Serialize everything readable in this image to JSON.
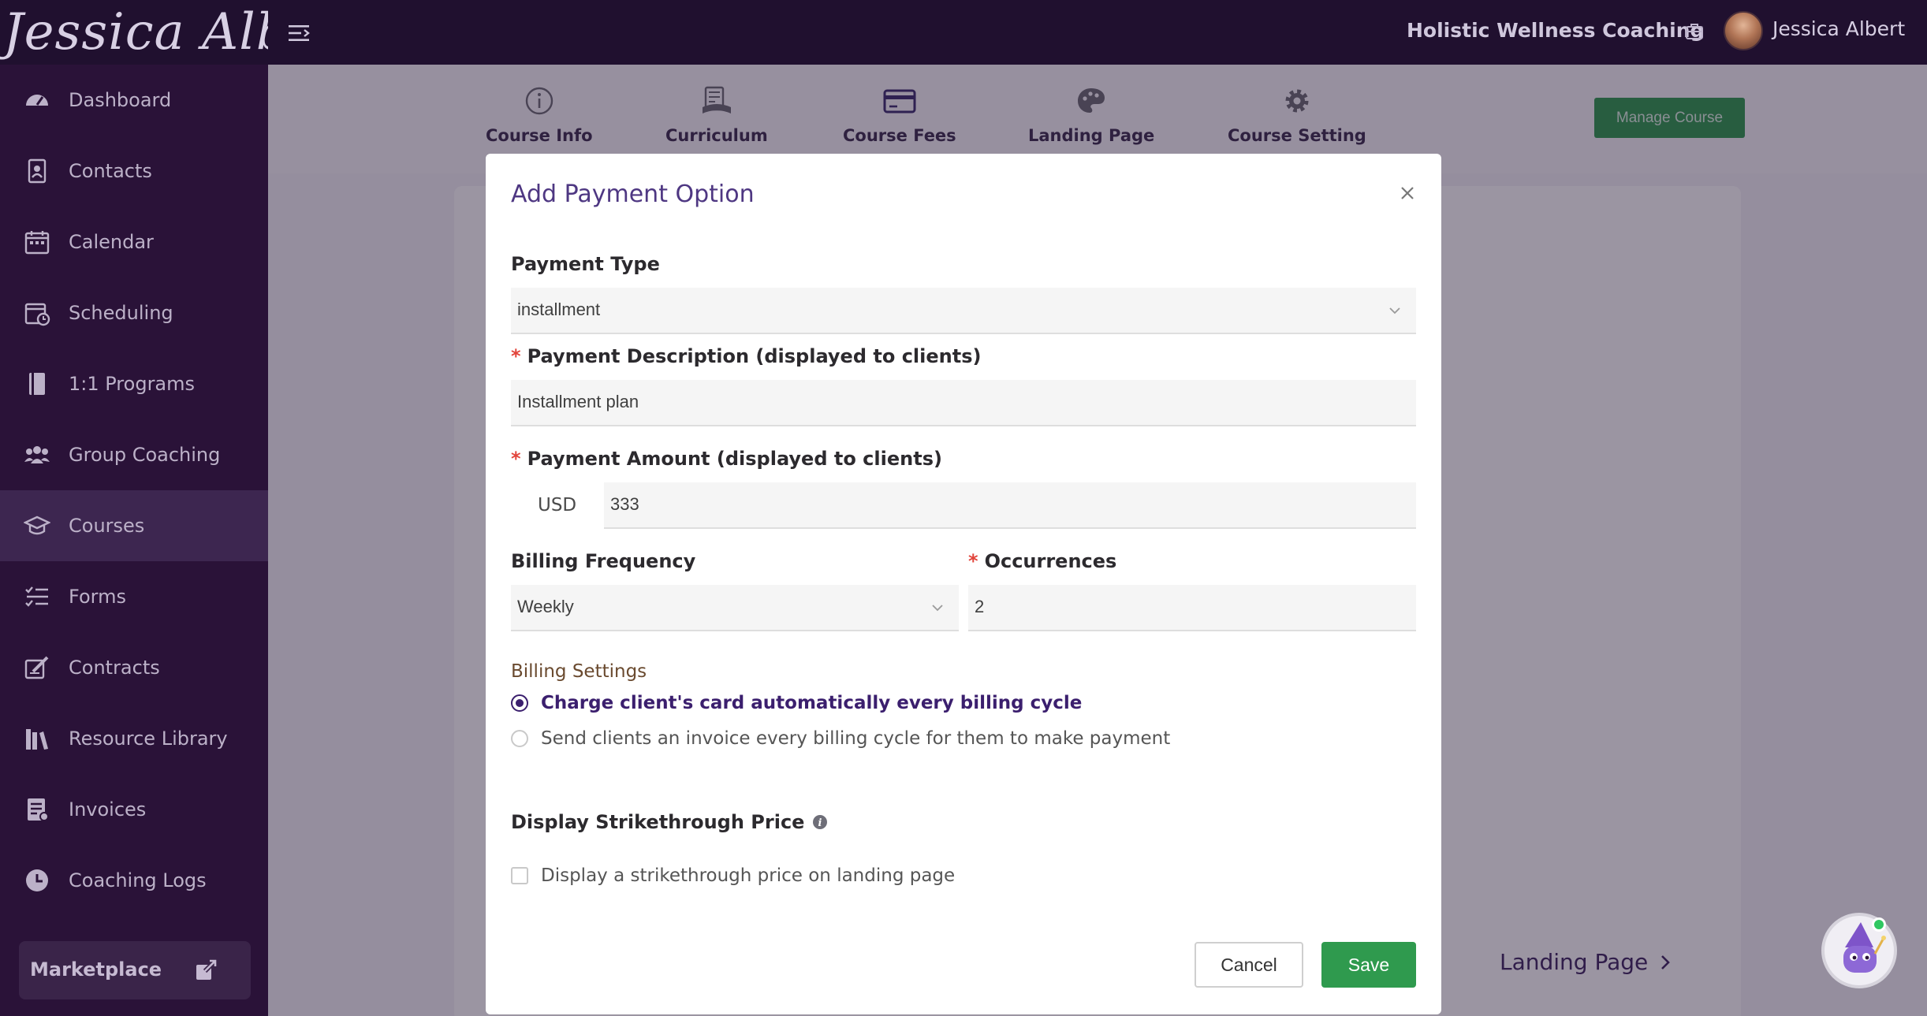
{
  "header": {
    "logo_text": "Jessica Albert",
    "org_name": "Holistic Wellness Coaching",
    "user_name": "Jessica Albert"
  },
  "sidebar": {
    "items": [
      {
        "label": "Dashboard",
        "icon": "dashboard-icon"
      },
      {
        "label": "Contacts",
        "icon": "contacts-icon"
      },
      {
        "label": "Calendar",
        "icon": "calendar-icon"
      },
      {
        "label": "Scheduling",
        "icon": "scheduling-icon"
      },
      {
        "label": "1:1 Programs",
        "icon": "programs-icon"
      },
      {
        "label": "Group Coaching",
        "icon": "group-icon"
      },
      {
        "label": "Courses",
        "icon": "courses-icon",
        "active": true
      },
      {
        "label": "Forms",
        "icon": "forms-icon"
      },
      {
        "label": "Contracts",
        "icon": "contracts-icon"
      },
      {
        "label": "Resource Library",
        "icon": "library-icon"
      },
      {
        "label": "Invoices",
        "icon": "invoices-icon"
      },
      {
        "label": "Coaching Logs",
        "icon": "clock-icon"
      }
    ],
    "marketplace_label": "Marketplace"
  },
  "course_tabs": [
    {
      "label": "Course Info",
      "icon": "info-icon"
    },
    {
      "label": "Curriculum",
      "icon": "curriculum-icon"
    },
    {
      "label": "Course Fees",
      "icon": "credit-card-icon",
      "active": true
    },
    {
      "label": "Landing Page",
      "icon": "palette-icon"
    },
    {
      "label": "Course Setting",
      "icon": "gear-icon"
    }
  ],
  "manage_course_label": "Manage Course",
  "landing_page_link": "Landing Page",
  "modal": {
    "title": "Add Payment Option",
    "payment_type_label": "Payment Type",
    "payment_type_value": "installment",
    "description_label": "Payment Description (displayed to clients)",
    "description_value": "Installment plan",
    "amount_label": "Payment Amount (displayed to clients)",
    "currency": "USD",
    "amount_value": "333",
    "billing_frequency_label": "Billing Frequency",
    "billing_frequency_value": "Weekly",
    "occurrences_label": "Occurrences",
    "occurrences_value": "2",
    "billing_settings_label": "Billing Settings",
    "radio_auto_charge": "Charge client's card automatically every billing cycle",
    "radio_invoice": "Send clients an invoice every billing cycle for them to make payment",
    "strikethrough_label": "Display Strikethrough Price",
    "strikethrough_checkbox": "Display a strikethrough price on landing page",
    "cancel_label": "Cancel",
    "save_label": "Save",
    "required_mark": "*"
  },
  "colors": {
    "topbar": "#20102f",
    "sidebar": "#2a1238",
    "accent_purple": "#4e3782",
    "save_green": "#2f9a4e",
    "required_red": "#e2443b"
  }
}
